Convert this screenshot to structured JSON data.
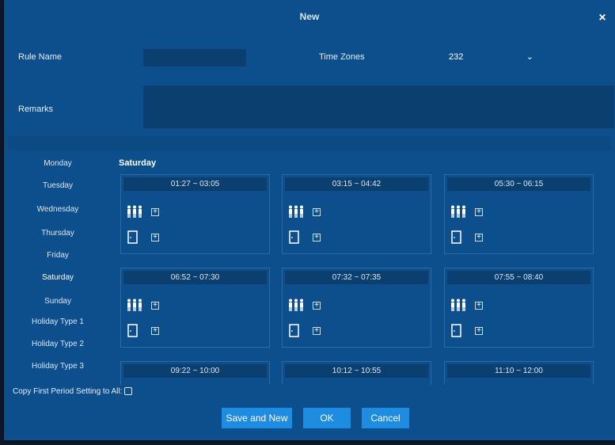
{
  "dialog": {
    "title": "New",
    "close_symbol": "×"
  },
  "form": {
    "rule_name_label": "Rule Name",
    "rule_name_value": "",
    "time_zones_label": "Time Zones",
    "time_zones_value": "232",
    "remarks_label": "Remarks",
    "remarks_value": ""
  },
  "days": [
    {
      "label": "Monday"
    },
    {
      "label": "Tuesday"
    },
    {
      "label": "Wednesday"
    },
    {
      "label": "Thursday"
    },
    {
      "label": "Friday"
    },
    {
      "label": "Saturday"
    },
    {
      "label": "Sunday"
    },
    {
      "label": "Holiday Type 1"
    },
    {
      "label": "Holiday Type 2"
    },
    {
      "label": "Holiday Type 3"
    }
  ],
  "selected_day": "Saturday",
  "periods": [
    {
      "time": "01:27 ~ 03:05"
    },
    {
      "time": "03:15 ~ 04:42"
    },
    {
      "time": "05:30 ~ 06:15"
    },
    {
      "time": "06:52 ~ 07:30"
    },
    {
      "time": "07:32 ~ 07:35"
    },
    {
      "time": "07:55 ~ 08:40"
    },
    {
      "time": "09:22 ~ 10:00"
    },
    {
      "time": "10:12 ~ 10:55"
    },
    {
      "time": "11:10 ~ 12:00"
    }
  ],
  "copy_label": "Copy First Period Setting to All:",
  "buttons": {
    "save_new": "Save and New",
    "ok": "OK",
    "cancel": "Cancel"
  },
  "icons": {
    "people": "people-icon",
    "door": "door-icon",
    "plus": "plus-box-icon",
    "chevron": "chevron-down-icon",
    "close": "close-icon"
  }
}
